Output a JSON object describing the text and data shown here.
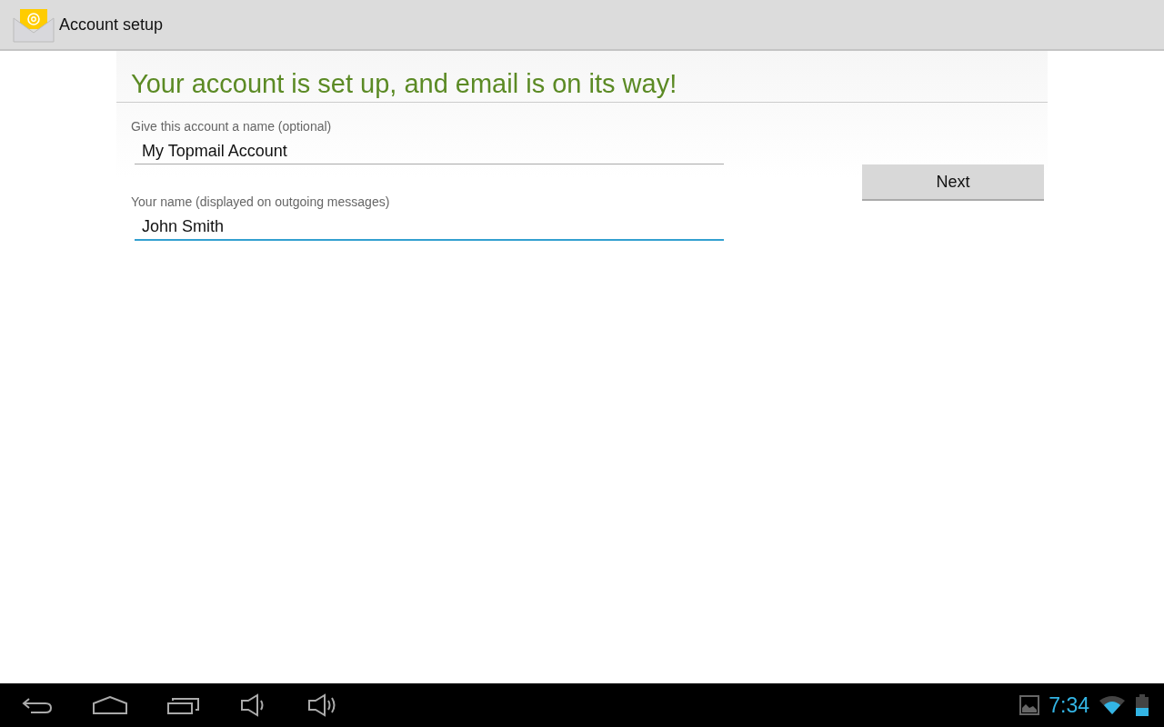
{
  "action_bar": {
    "title": "Account setup"
  },
  "heading": "Your account is set up, and email is on its way!",
  "fields": [
    {
      "label": "Give this account a name (optional)",
      "value": "My Topmail Account",
      "focused": false
    },
    {
      "label": "Your name (displayed on outgoing messages)",
      "value": "John Smith",
      "focused": true
    }
  ],
  "buttons": [
    "Next"
  ],
  "status_bar": {
    "time": "7:34"
  }
}
